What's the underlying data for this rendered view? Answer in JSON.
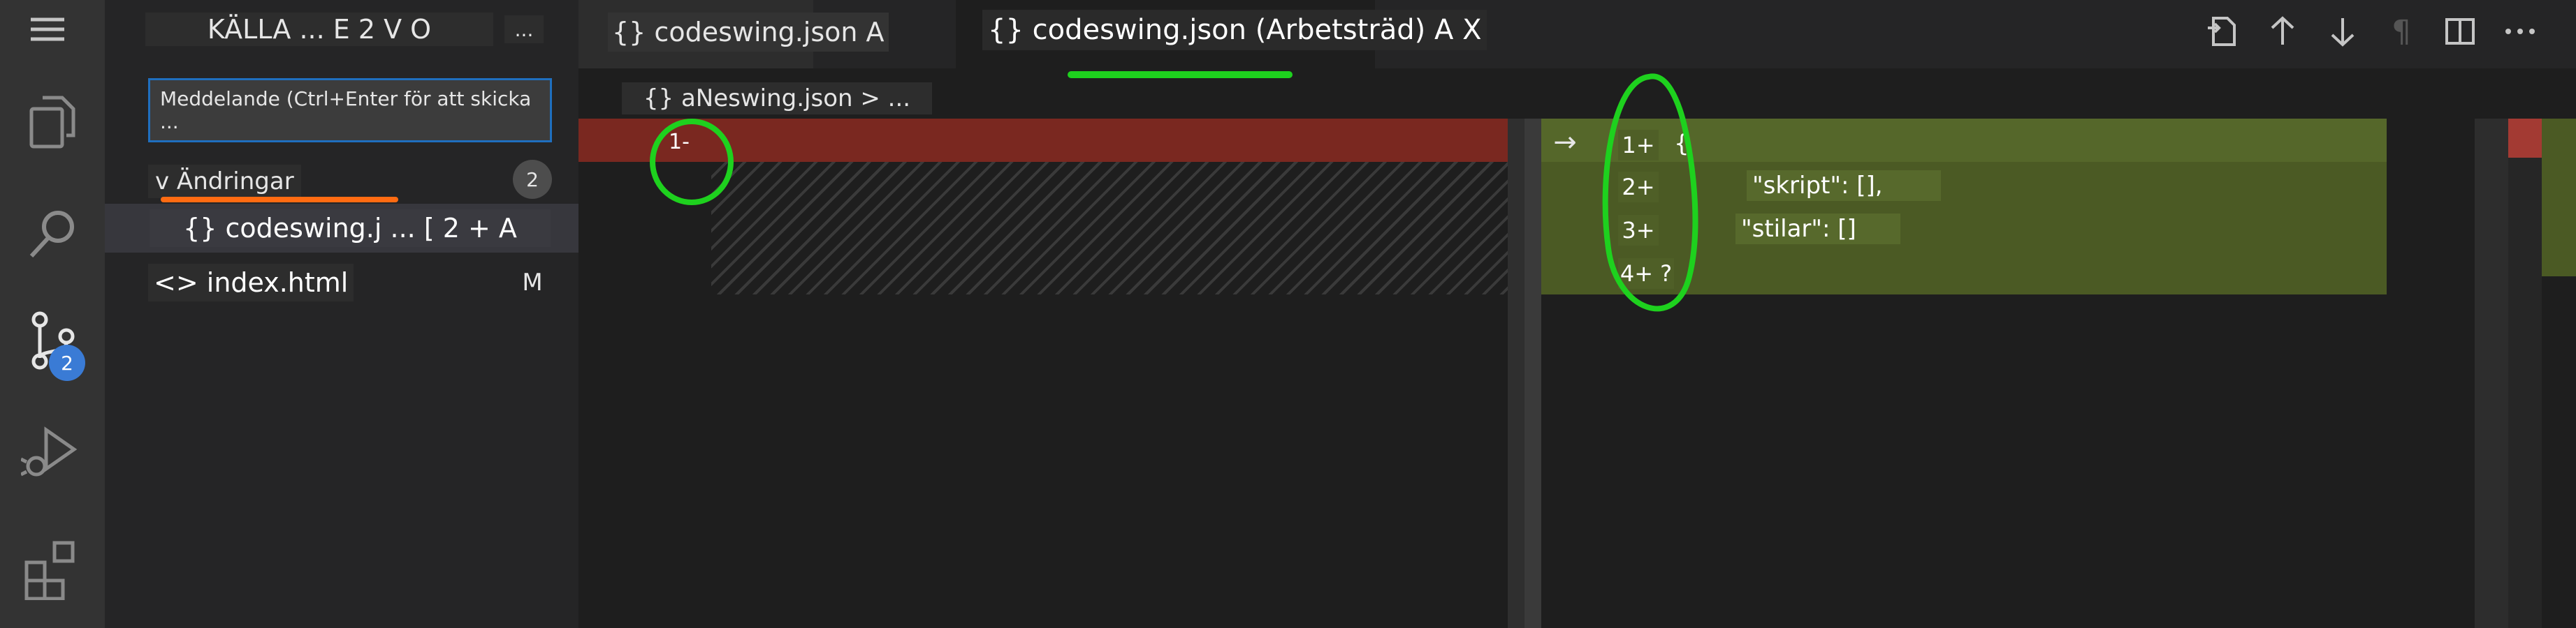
{
  "sidebar": {
    "title": "KÄLLA ... E 2 V O",
    "more": "...",
    "message_placeholder": "Meddelande (Ctrl+Enter för att skicka ...",
    "changes_label": "v Ändringar",
    "changes_count": "2",
    "files": [
      {
        "label": "{} codeswing.j ... [ 2 + A",
        "status": ""
      },
      {
        "label": "<> index.html",
        "status": "M"
      }
    ]
  },
  "activity": {
    "scm_badge": "2"
  },
  "tabs": [
    {
      "label": "{} codeswing.json A"
    },
    {
      "label": "{} codeswing.json (Arbetsträd) A X"
    }
  ],
  "breadcrumb": "{} aNeswing.json > ...",
  "diff": {
    "left_line": "1-",
    "right_lines": [
      {
        "num": "1+",
        "text": "{"
      },
      {
        "num": "2+",
        "text": "\"skript\": [],",
        "indent": 1
      },
      {
        "num": "3+",
        "text": "\"stilar\": []",
        "indent": 1
      },
      {
        "num": "4+ ?",
        "text": ""
      }
    ]
  },
  "colors": {
    "accent_blue": "#3a7bd5",
    "deleted_line": "#7a2820",
    "added_line": "#4b5a24",
    "annotation_green": "#1ed11e",
    "annotation_orange": "#ff6b12"
  }
}
